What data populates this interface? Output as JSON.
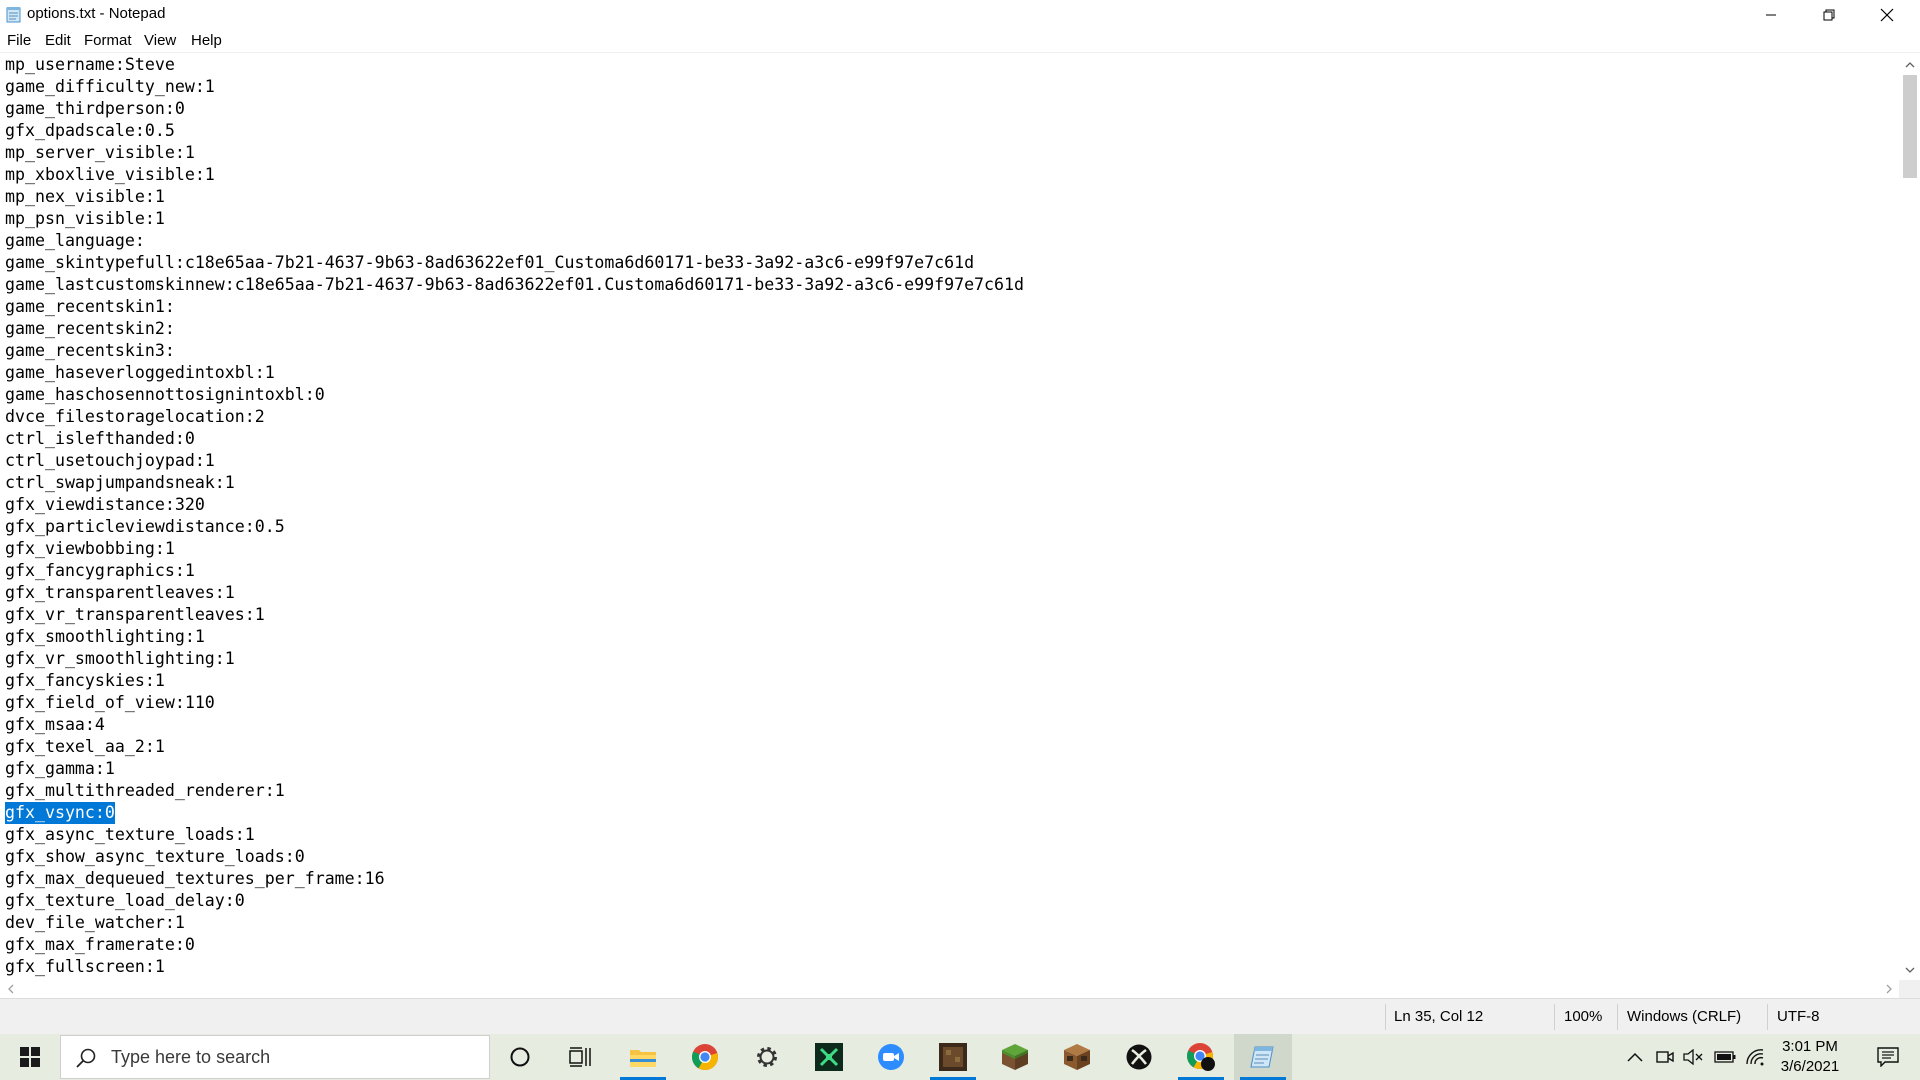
{
  "window": {
    "title": "options.txt - Notepad"
  },
  "menu": {
    "items": [
      "File",
      "Edit",
      "Format",
      "View",
      "Help"
    ]
  },
  "editor": {
    "lines": [
      "mp_username:Steve",
      "game_difficulty_new:1",
      "game_thirdperson:0",
      "gfx_dpadscale:0.5",
      "mp_server_visible:1",
      "mp_xboxlive_visible:1",
      "mp_nex_visible:1",
      "mp_psn_visible:1",
      "game_language:",
      "game_skintypefull:c18e65aa-7b21-4637-9b63-8ad63622ef01_Customa6d60171-be33-3a92-a3c6-e99f97e7c61d",
      "game_lastcustomskinnew:c18e65aa-7b21-4637-9b63-8ad63622ef01.Customa6d60171-be33-3a92-a3c6-e99f97e7c61d",
      "game_recentskin1:",
      "game_recentskin2:",
      "game_recentskin3:",
      "game_haseverloggedintoxbl:1",
      "game_haschosennottosignintoxbl:0",
      "dvce_filestoragelocation:2",
      "ctrl_islefthanded:0",
      "ctrl_usetouchjoypad:1",
      "ctrl_swapjumpandsneak:1",
      "gfx_viewdistance:320",
      "gfx_particleviewdistance:0.5",
      "gfx_viewbobbing:1",
      "gfx_fancygraphics:1",
      "gfx_transparentleaves:1",
      "gfx_vr_transparentleaves:1",
      "gfx_smoothlighting:1",
      "gfx_vr_smoothlighting:1",
      "gfx_fancyskies:1",
      "gfx_field_of_view:110",
      "gfx_msaa:4",
      "gfx_texel_aa_2:1",
      "gfx_gamma:1",
      "gfx_multithreaded_renderer:1",
      "gfx_vsync:0",
      "gfx_async_texture_loads:1",
      "gfx_show_async_texture_loads:0",
      "gfx_max_dequeued_textures_per_frame:16",
      "gfx_texture_load_delay:0",
      "dev_file_watcher:1",
      "gfx_max_framerate:0",
      "gfx_fullscreen:1"
    ],
    "selected_line": 34,
    "scroll_position": 0.0
  },
  "status": {
    "position": "Ln 35, Col 12",
    "zoom": "100%",
    "line_ending": "Windows (CRLF)",
    "encoding": "UTF-8"
  },
  "taskbar": {
    "search_placeholder": "Type here to search",
    "pinned": [
      {
        "name": "cortana-icon"
      },
      {
        "name": "task-view-icon"
      },
      {
        "name": "file-explorer-icon",
        "running": true
      },
      {
        "name": "chrome-icon"
      },
      {
        "name": "settings-gear-icon"
      },
      {
        "name": "xbox-game-bar-icon"
      },
      {
        "name": "zoom-icon"
      },
      {
        "name": "minecraft-launcher-icon",
        "running": true
      },
      {
        "name": "minecraft-grass-block-icon"
      },
      {
        "name": "minecraft-crafting-table-icon"
      },
      {
        "name": "xbox-icon"
      },
      {
        "name": "chrome-profile-icon",
        "running": true
      },
      {
        "name": "notepad-icon",
        "active": true
      }
    ],
    "time": "3:01 PM",
    "date": "3/6/2021"
  },
  "colors": {
    "selection": "#0078d7",
    "taskbar": "#e6ece0",
    "accent": "#0078d7"
  }
}
